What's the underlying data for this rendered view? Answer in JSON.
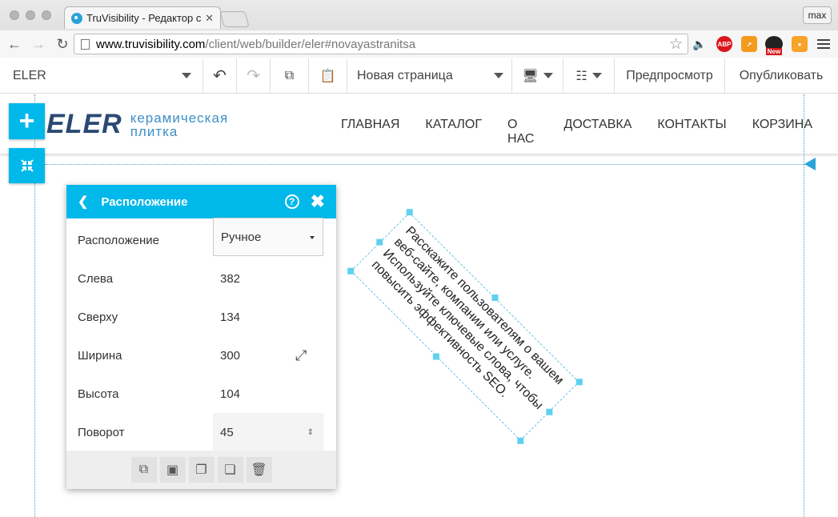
{
  "browser": {
    "tab_title": "TruVisibility - Редактор са",
    "tab_close": "✕",
    "user_label": "max",
    "url_host": "www.truvisibility.com",
    "url_path": "/client/web/builder/eler#novayastranitsa",
    "extensions": [
      "speaker-icon",
      "adblock-icon",
      "chart-icon",
      "new-badge-icon",
      "rss-icon",
      "menu-icon"
    ],
    "abp_label": "ABP",
    "new_label": "New"
  },
  "editor_toolbar": {
    "site_name": "ELER",
    "page_name": "Новая страница",
    "preview_label": "Предпросмотр",
    "publish_label": "Опубликовать"
  },
  "site": {
    "logo_main": "ELER",
    "logo_sub_line1": "керамическая",
    "logo_sub_line2": "плитка",
    "menu": [
      "ГЛАВНАЯ",
      "КАТАЛОГ",
      "О НАС",
      "ДОСТАВКА",
      "КОНТАКТЫ",
      "КОРЗИНА"
    ]
  },
  "side_buttons": {
    "add_label": "+"
  },
  "panel": {
    "title": "Расположение",
    "help": "?",
    "rows": [
      {
        "label": "Расположение",
        "value": "Ручное"
      },
      {
        "label": "Слева",
        "value": "382"
      },
      {
        "label": "Сверху",
        "value": "134"
      },
      {
        "label": "Ширина",
        "value": "300"
      },
      {
        "label": "Высота",
        "value": "104"
      },
      {
        "label": "Поворот",
        "value": "45"
      }
    ]
  },
  "text_block": {
    "content": "Расскажите пользователям о вашем веб-сайте, компании или услуге. Используйте ключевые слова, чтобы повысить эффективность SEO."
  },
  "colors": {
    "accent": "#00b8ea",
    "logo_dark": "#2a4a73",
    "logo_light": "#3d8fc8",
    "guide": "#4aa3c8"
  }
}
